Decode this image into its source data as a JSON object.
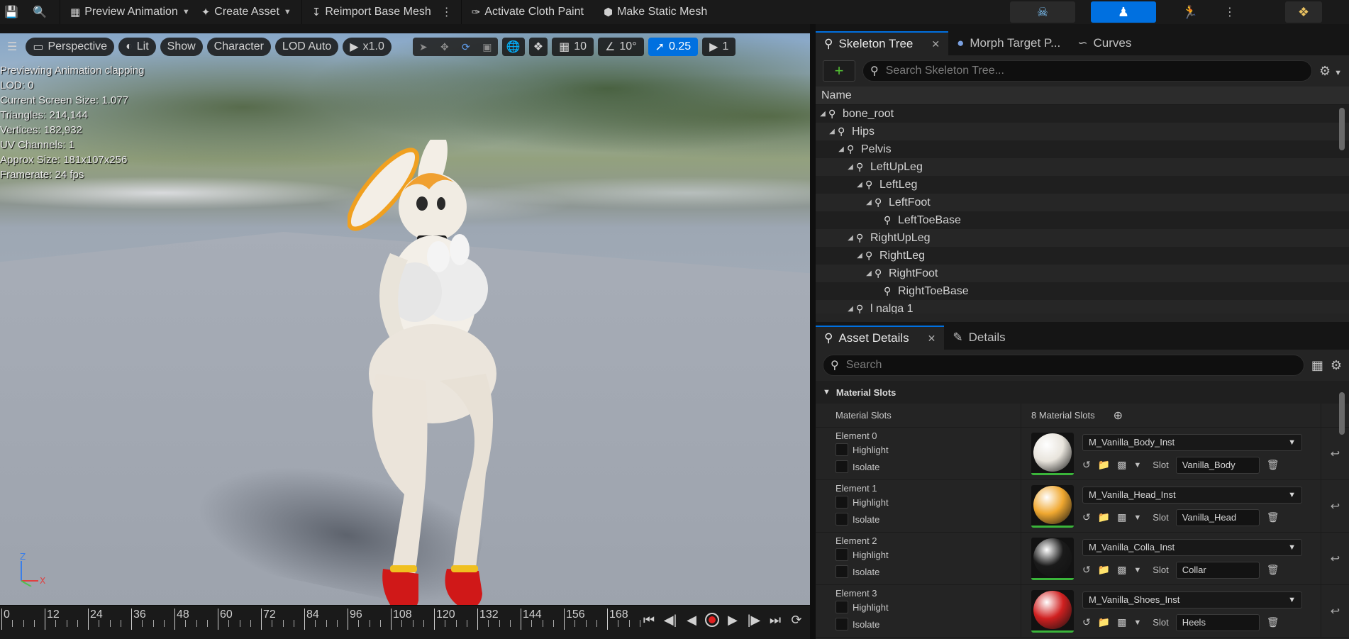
{
  "toolbar": {
    "preview_animation": "Preview Animation",
    "create_asset": "Create Asset",
    "reimport": "Reimport Base Mesh",
    "cloth_paint": "Activate Cloth Paint",
    "static_mesh": "Make Static Mesh"
  },
  "viewport": {
    "perspective": "Perspective",
    "lit": "Lit",
    "show": "Show",
    "character": "Character",
    "lod": "LOD Auto",
    "speed": "x1.0",
    "grid_value": "10",
    "angle_value": "10°",
    "scale_value": "0.25",
    "camera_value": "1",
    "stats": [
      "Previewing Animation clapping",
      "LOD: 0",
      "Current Screen Size: 1.077",
      "Triangles: 214,144",
      "Vertices: 182,932",
      "UV Channels: 1",
      "Approx Size: 181x107x256",
      "Framerate: 24 fps"
    ]
  },
  "timeline": {
    "ticks": [
      "0",
      "12",
      "24",
      "36",
      "48",
      "60",
      "72",
      "84",
      "96",
      "108",
      "120",
      "132",
      "144",
      "156",
      "168"
    ]
  },
  "skeleton_panel": {
    "tabs": [
      "Skeleton Tree",
      "Morph Target P...",
      "Curves"
    ],
    "search_placeholder": "Search Skeleton Tree...",
    "column_name": "Name",
    "bones": [
      {
        "name": "bone_root",
        "depth": 0
      },
      {
        "name": "Hips",
        "depth": 1
      },
      {
        "name": "Pelvis",
        "depth": 2
      },
      {
        "name": "LeftUpLeg",
        "depth": 3
      },
      {
        "name": "LeftLeg",
        "depth": 4
      },
      {
        "name": "LeftFoot",
        "depth": 5
      },
      {
        "name": "LeftToeBase",
        "depth": 6
      },
      {
        "name": "RightUpLeg",
        "depth": 3
      },
      {
        "name": "RightLeg",
        "depth": 4
      },
      {
        "name": "RightFoot",
        "depth": 5
      },
      {
        "name": "RightToeBase",
        "depth": 6
      },
      {
        "name": "l nalga 1",
        "depth": 3
      }
    ]
  },
  "details_panel": {
    "tabs": [
      "Asset Details",
      "Details"
    ],
    "search_placeholder": "Search",
    "section": "Material Slots",
    "slots_label": "Material Slots",
    "slots_count": "8 Material Slots",
    "highlight_label": "Highlight",
    "isolate_label": "Isolate",
    "slot_label": "Slot",
    "elements": [
      {
        "label": "Element 0",
        "material": "M_Vanilla_Body_Inst",
        "slot": "Vanilla_Body",
        "color": "#e8e4dc"
      },
      {
        "label": "Element 1",
        "material": "M_Vanilla_Head_Inst",
        "slot": "Vanilla_Head",
        "color": "#f0a830"
      },
      {
        "label": "Element 2",
        "material": "M_Vanilla_Colla_Inst",
        "slot": "Collar",
        "color": "#1a1a1a"
      },
      {
        "label": "Element 3",
        "material": "M_Vanilla_Shoes_Inst",
        "slot": "Heels",
        "color": "#d02020"
      }
    ]
  },
  "colors": {
    "accent": "#0070e0",
    "add_green": "#53c034"
  }
}
